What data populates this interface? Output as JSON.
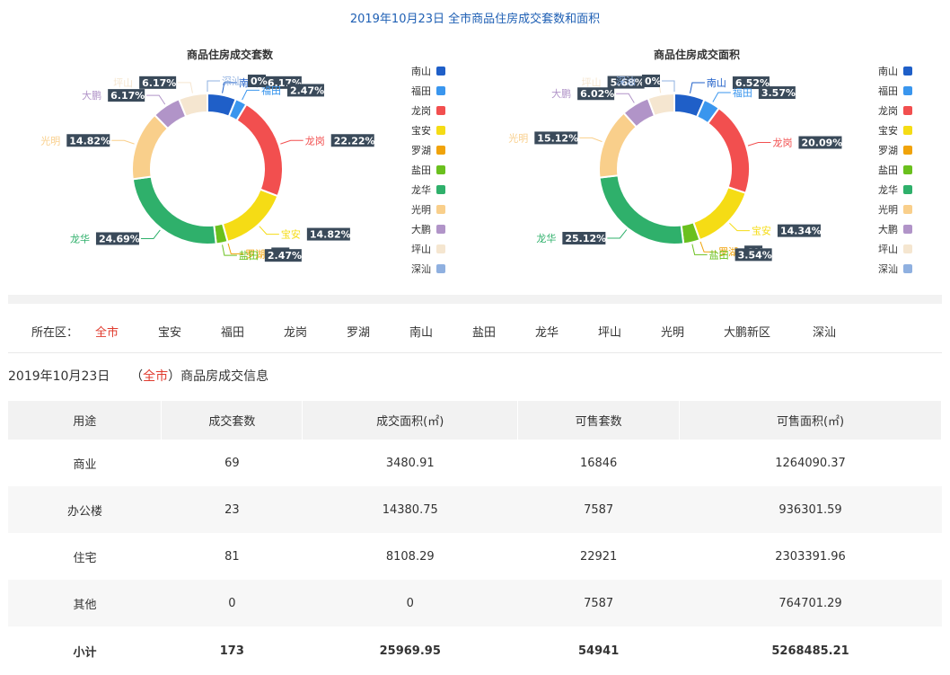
{
  "header": {
    "title": "2019年10月23日 全市商品住房成交套数和面积"
  },
  "legend_items": [
    {
      "name": "南山",
      "color": "#1f5fc8"
    },
    {
      "name": "福田",
      "color": "#3a96ee"
    },
    {
      "name": "龙岗",
      "color": "#f24f4f"
    },
    {
      "name": "宝安",
      "color": "#f5dc15"
    },
    {
      "name": "罗湖",
      "color": "#f0a30a"
    },
    {
      "name": "盐田",
      "color": "#6ac01e"
    },
    {
      "name": "龙华",
      "color": "#2fb06b"
    },
    {
      "name": "光明",
      "color": "#f9cf8b"
    },
    {
      "name": "大鹏",
      "color": "#b194c8"
    },
    {
      "name": "坪山",
      "color": "#f5e6d0"
    },
    {
      "name": "深汕",
      "color": "#8fb0e0"
    }
  ],
  "chart_data": [
    {
      "type": "pie",
      "title": "商品住房成交套数",
      "slices": [
        {
          "name": "南山",
          "value": 6.17,
          "label": "6.17%"
        },
        {
          "name": "福田",
          "value": 2.47,
          "label": "2.47%"
        },
        {
          "name": "龙岗",
          "value": 22.22,
          "label": "22.22%"
        },
        {
          "name": "宝安",
          "value": 14.82,
          "label": "14.82%"
        },
        {
          "name": "罗湖",
          "value": 0,
          "label": "0%"
        },
        {
          "name": "盐田",
          "value": 2.47,
          "label": "2.47%"
        },
        {
          "name": "龙华",
          "value": 24.69,
          "label": "24.69%"
        },
        {
          "name": "光明",
          "value": 14.82,
          "label": "14.82%"
        },
        {
          "name": "大鹏",
          "value": 6.17,
          "label": "6.17%"
        },
        {
          "name": "坪山",
          "value": 6.17,
          "label": "6.17%"
        },
        {
          "name": "深汕",
          "value": 0,
          "label": "0%"
        }
      ]
    },
    {
      "type": "pie",
      "title": "商品住房成交面积",
      "slices": [
        {
          "name": "南山",
          "value": 6.52,
          "label": "6.52%"
        },
        {
          "name": "福田",
          "value": 3.57,
          "label": "3.57%"
        },
        {
          "name": "龙岗",
          "value": 20.09,
          "label": "20.09%"
        },
        {
          "name": "宝安",
          "value": 14.34,
          "label": "14.34%"
        },
        {
          "name": "罗湖",
          "value": 0,
          "label": "0%"
        },
        {
          "name": "盐田",
          "value": 3.54,
          "label": "3.54%"
        },
        {
          "name": "龙华",
          "value": 25.12,
          "label": "25.12%"
        },
        {
          "name": "光明",
          "value": 15.12,
          "label": "15.12%"
        },
        {
          "name": "大鹏",
          "value": 6.02,
          "label": "6.02%"
        },
        {
          "name": "坪山",
          "value": 5.68,
          "label": "5.68%"
        },
        {
          "name": "深汕",
          "value": 0,
          "label": "0%"
        }
      ]
    }
  ],
  "region_filter": {
    "label": "所在区：",
    "active": "全市",
    "items": [
      "全市",
      "宝安",
      "福田",
      "龙岗",
      "罗湖",
      "南山",
      "盐田",
      "龙华",
      "坪山",
      "光明",
      "大鹏新区",
      "深汕"
    ]
  },
  "info": {
    "date": "2019年10月23日",
    "open_paren": "（",
    "region": "全市",
    "close_paren": "）",
    "suffix": "商品房成交信息"
  },
  "table": {
    "headers": [
      "用途",
      "成交套数",
      "成交面积(㎡)",
      "可售套数",
      "可售面积(㎡)"
    ],
    "rows": [
      [
        "商业",
        "69",
        "3480.91",
        "16846",
        "1264090.37"
      ],
      [
        "办公楼",
        "23",
        "14380.75",
        "7587",
        "936301.59"
      ],
      [
        "住宅",
        "81",
        "8108.29",
        "22921",
        "2303391.96"
      ],
      [
        "其他",
        "0",
        "0",
        "7587",
        "764701.29"
      ]
    ],
    "total": [
      "小计",
      "173",
      "25969.95",
      "54941",
      "5268485.21"
    ]
  }
}
